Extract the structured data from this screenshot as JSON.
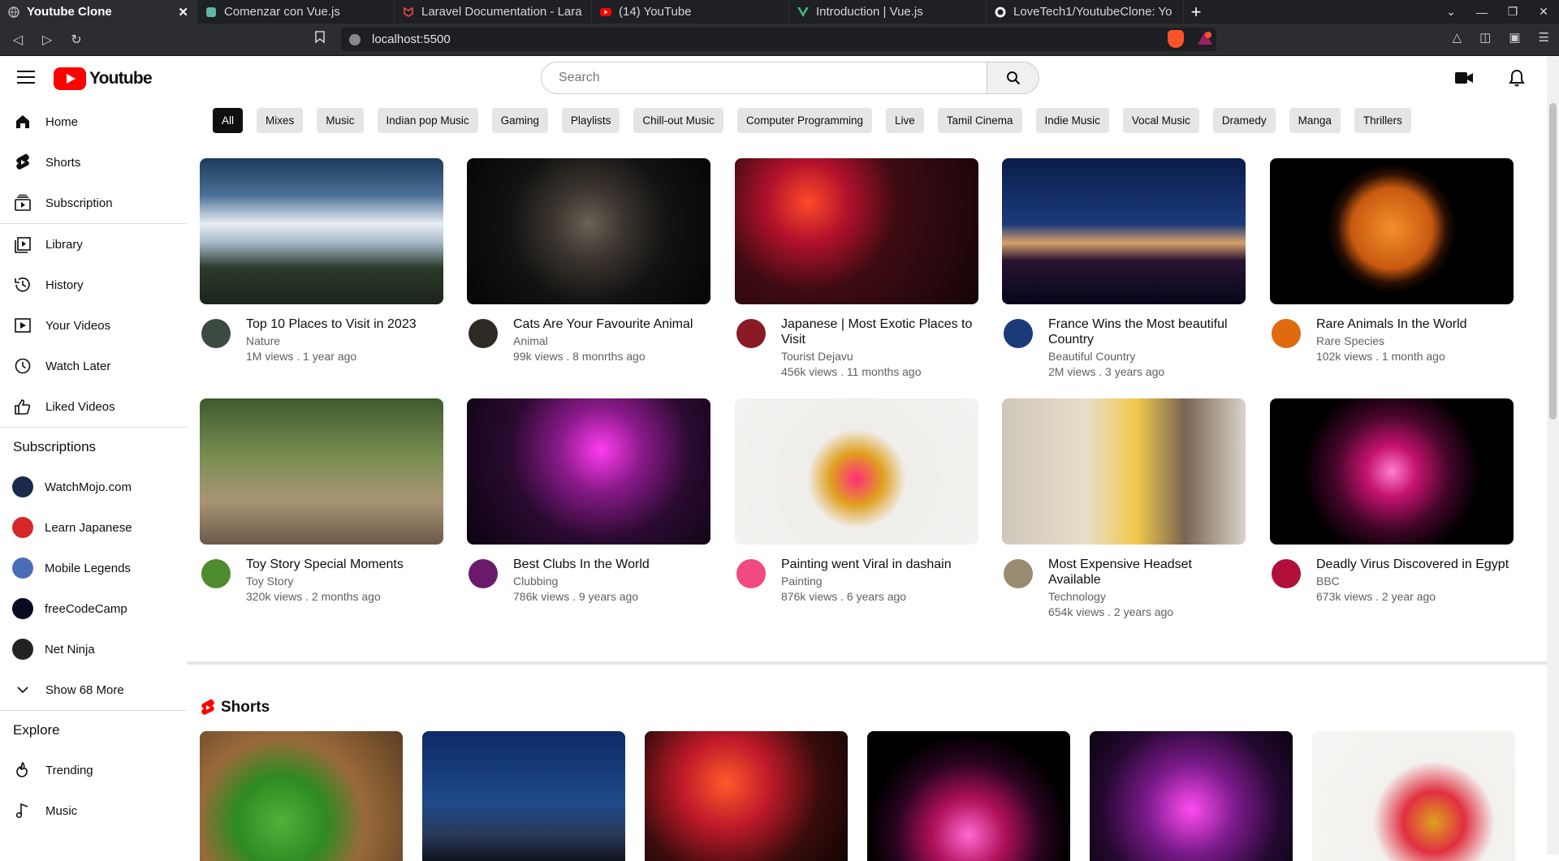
{
  "browser": {
    "tabs": [
      {
        "title": "Youtube Clone",
        "icon": "globe-icon",
        "active": true
      },
      {
        "title": "Comenzar con Vue.js",
        "icon": "page-icon"
      },
      {
        "title": "Laravel Documentation - Lara",
        "icon": "laravel-icon"
      },
      {
        "title": "(14) YouTube",
        "icon": "youtube-icon"
      },
      {
        "title": "Introduction | Vue.js",
        "icon": "vue-icon"
      },
      {
        "title": "LoveTech1/YoutubeClone: Yo",
        "icon": "github-icon"
      }
    ],
    "url": "localhost:5500",
    "shields_badge": "1"
  },
  "app": {
    "logo_text": "Youtube",
    "search_placeholder": "Search"
  },
  "sidebar": {
    "main": [
      {
        "label": "Home",
        "icon": "home-icon"
      },
      {
        "label": "Shorts",
        "icon": "shorts-icon"
      },
      {
        "label": "Subscription",
        "icon": "subscription-icon"
      }
    ],
    "library": [
      {
        "label": "Library",
        "icon": "library-icon"
      },
      {
        "label": "History",
        "icon": "history-icon"
      },
      {
        "label": "Your Videos",
        "icon": "your-videos-icon"
      },
      {
        "label": "Watch Later",
        "icon": "clock-icon"
      },
      {
        "label": "Liked Videos",
        "icon": "thumbs-up-icon"
      }
    ],
    "subscriptions_title": "Subscriptions",
    "subscriptions": [
      {
        "label": "WatchMojo.com",
        "color": "#1a2a4a"
      },
      {
        "label": "Learn Japanese",
        "color": "#d62828"
      },
      {
        "label": "Mobile Legends",
        "color": "#4b6cb7"
      },
      {
        "label": "freeCodeCamp",
        "color": "#0a0a23"
      },
      {
        "label": "Net Ninja",
        "color": "#222222"
      }
    ],
    "show_more": "Show 68 More",
    "explore_title": "Explore",
    "explore": [
      {
        "label": "Trending",
        "icon": "trending-icon"
      },
      {
        "label": "Music",
        "icon": "music-icon"
      }
    ]
  },
  "chips": [
    "All",
    "Mixes",
    "Music",
    "Indian pop Music",
    "Gaming",
    "Playlists",
    "Chill-out Music",
    "Computer Programming",
    "Live",
    "Tamil Cinema",
    "Indie Music",
    "Vocal Music",
    "Dramedy",
    "Manga",
    "Thrillers"
  ],
  "videos": [
    {
      "title": "Top 10 Places to Visit in 2023",
      "channel": "Nature",
      "stats": "1M views . 1 year ago"
    },
    {
      "title": "Cats Are Your Favourite Animal",
      "channel": "Animal",
      "stats": "99k views . 8 monrths ago"
    },
    {
      "title": "Japanese | Most Exotic Places to Visit",
      "channel": "Tourist Dejavu",
      "stats": "456k views . 11 months ago"
    },
    {
      "title": "France Wins the Most beautiful Country",
      "channel": "Beautiful Country",
      "stats": "2M views . 3 years ago"
    },
    {
      "title": "Rare Animals In the World",
      "channel": "Rare Species",
      "stats": "102k views . 1 month ago"
    },
    {
      "title": "Toy Story Special Moments",
      "channel": "Toy Story",
      "stats": "320k views . 2 months ago"
    },
    {
      "title": "Best Clubs In the World",
      "channel": "Clubbing",
      "stats": "786k views . 9 years ago"
    },
    {
      "title": "Painting went Viral in dashain",
      "channel": "Painting",
      "stats": "876k views . 6 years ago"
    },
    {
      "title": "Most Expensive Headset Available",
      "channel": "Technology",
      "stats": "654k views . 2 years ago"
    },
    {
      "title": "Deadly Virus Discovered in Egypt",
      "channel": "BBC",
      "stats": "673k views . 2 year ago"
    }
  ],
  "shorts_title": "Shorts",
  "shorts_count": 6
}
